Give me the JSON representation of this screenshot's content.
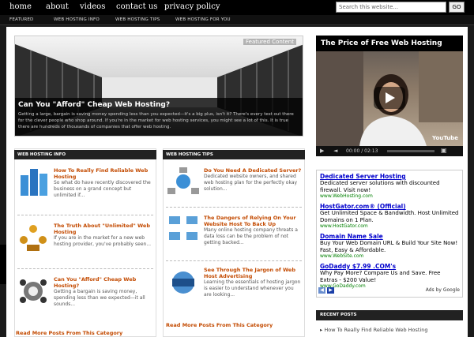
{
  "nav": {
    "items": [
      "home",
      "about",
      "videos",
      "contact us",
      "privacy policy"
    ],
    "search_placeholder": "Search this website...",
    "go_label": "GO"
  },
  "subnav": {
    "items": [
      "FEATURED",
      "WEB HOSTING INFO",
      "WEB HOSTING TIPS",
      "WEB HOSTING FOR YOU"
    ]
  },
  "featured": {
    "tag": "Featured Content",
    "title": "Can You \"Afford\" Cheap Web Hosting?",
    "text": "Getting a large, bargain is saving money spending less than you expected—it's a big plus, isn't it? There's every test out there for the clever people who shop around. If you're in the market for web hosting services, you might see a lot of this. It is true there are hundreds of thousands of companies that offer web hosting."
  },
  "video": {
    "title": "The Price of Free Web Hosting",
    "time": "00:00 / 02:13",
    "brand": "YouTube"
  },
  "sections": {
    "info": "WEB HOSTING INFO",
    "tips": "WEB HOSTING TIPS",
    "recent": "RECENT POSTS"
  },
  "info_posts": [
    {
      "title": "How To Really Find Reliable Web Hosting",
      "text": "So what do have recently discovered the business on a grand concept but unlimited if..."
    },
    {
      "title": "The Truth About \"Unlimited\" Web Hosting",
      "text": "If you are in the market for a new web hosting provider, you've probably seen..."
    },
    {
      "title": "Can You \"Afford\" Cheap Web Hosting?",
      "text": "Getting a bargain is saving money, spending less than we expected—it all sounds..."
    }
  ],
  "tips_posts": [
    {
      "title": "Do You Need A Dedicated Server?",
      "text": "Dedicated website owners, and shared web hosting plan for the perfectly okay solution..."
    },
    {
      "title": "The Dangers of Relying On Your Website Host To Back Up",
      "text": "Many online hosting company threats a data loss can be the problem of not getting backed..."
    },
    {
      "title": "See Through The Jargon of Web Host Advertising",
      "text": "Learning the essentials of hosting jargon is easier to understand whenever you are looking..."
    }
  ],
  "more_info": "Read More Posts From This Category",
  "more_tips": "Read More Posts From This Category",
  "ads": [
    {
      "headline": "Dedicated Server Hosting",
      "desc": "Dedicated server solutions with discounted firewall. Visit now!",
      "url": "www.WebHosting.com"
    },
    {
      "headline": "HostGator.com® (Official)",
      "desc": "Get Unlimited Space & Bandwidth. Host Unlimited Domains on 1 Plan.",
      "url": "www.HostGator.com"
    },
    {
      "headline": "Domain Name Sale",
      "desc": "Buy Your Web Domain URL & Build Your Site Now! Fast, Easy & Affordable.",
      "url": "www.WebSite.com"
    },
    {
      "headline": "GoDaddy $7.99 .COM's",
      "desc": "Why Pay More? Compare Us and Save. Free Extras - $200 Value!",
      "url": "www.GoDaddy.com"
    }
  ],
  "ads_by": "Ads by Google",
  "recent_post": "How To Really Find Reliable Web Hosting",
  "colors": {
    "accent": "#c34a00",
    "ad_link": "#0000cc",
    "ad_url": "#008000",
    "header": "#222222"
  }
}
